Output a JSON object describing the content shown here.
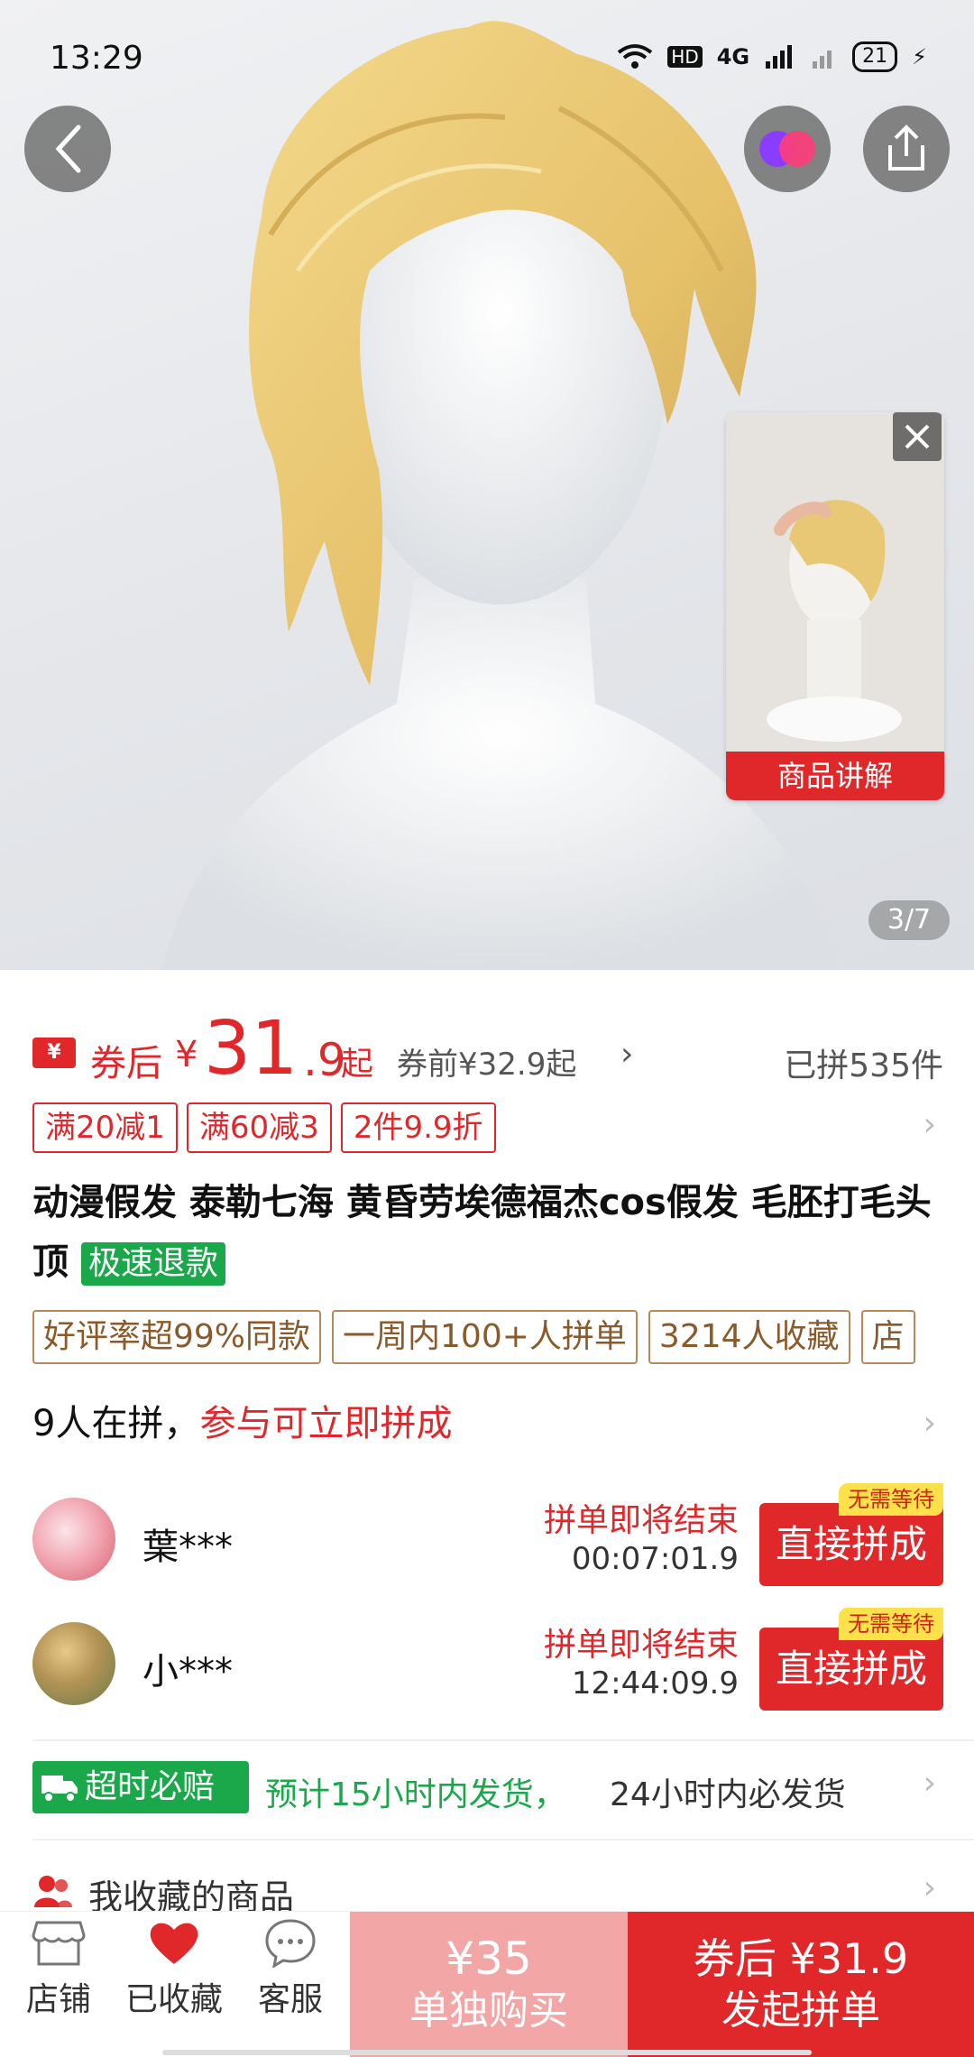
{
  "status": {
    "time": "13:29",
    "battery": "21",
    "network": "4G"
  },
  "hero": {
    "page_indicator": "3/7",
    "video_label": "商品讲解"
  },
  "price": {
    "prefix": "券后",
    "symbol": "¥",
    "integer": "31",
    "decimal": ".9",
    "suffix": "起",
    "before": "券前¥32.9起",
    "sold": "已拼535件",
    "coupon_badge": "¥"
  },
  "promos": [
    "满20减1",
    "满60减3",
    "2件9.9折"
  ],
  "product": {
    "title": "动漫假发 泰勒七海 黄昏劳埃德福杰cos假发 毛胚打毛头顶",
    "refund_tag": "极速退款"
  },
  "info_tags": [
    "好评率超99%同款",
    "一周内100+人拼单",
    "3214人收藏",
    "店"
  ],
  "group_buy": {
    "count_text": "9人在拼，",
    "cta_text": "参与可立即拼成",
    "rows": [
      {
        "name": "葉***",
        "status": "拼单即将结束",
        "timer": "00:07:01.9",
        "button": "直接拼成",
        "badge": "无需等待"
      },
      {
        "name": "小***",
        "status": "拼单即将结束",
        "timer": "12:44:09.9",
        "button": "直接拼成",
        "badge": "无需等待"
      }
    ]
  },
  "shipping": {
    "badge": "超时必赔",
    "green_text": "预计15小时内发货，",
    "gray_text": "24小时内必发货"
  },
  "favorites": {
    "label": "我收藏的商品"
  },
  "bottom_nav": {
    "store": "店铺",
    "favorited": "已收藏",
    "service": "客服",
    "buy_alone_price": "¥35",
    "buy_alone_label": "单独购买",
    "buy_group_price": "券后 ¥31.9",
    "buy_group_label": "发起拼单"
  },
  "colors": {
    "accent": "#e0282b",
    "green": "#1aa84a",
    "tag_brown": "#b58a5a"
  }
}
